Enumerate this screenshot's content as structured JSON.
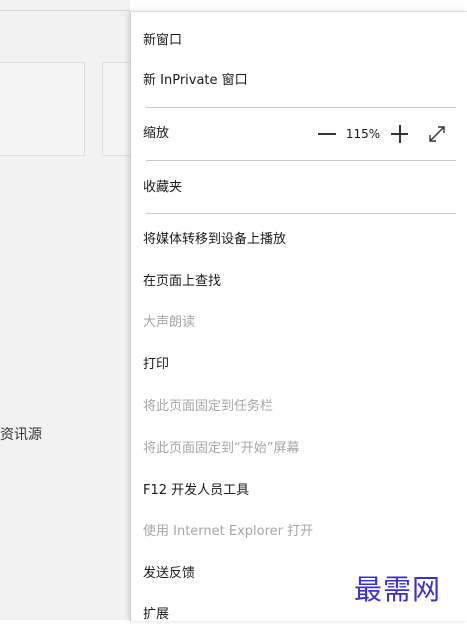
{
  "background": {
    "feed_label": "资讯源"
  },
  "menu": {
    "new_window": "新窗口",
    "new_inprivate": "新 InPrivate 窗口",
    "zoom": {
      "label": "缩放",
      "value": "115%"
    },
    "favorites": "收藏夹",
    "cast": "将媒体转移到设备上播放",
    "find": "在页面上查找",
    "read_aloud": "大声朗读",
    "print": "打印",
    "pin_taskbar": "将此页面固定到任务栏",
    "pin_start": "将此页面固定到“开始”屏幕",
    "dev_tools": "F12 开发人员工具",
    "open_ie": "使用 Internet Explorer 打开",
    "feedback": "发送反馈",
    "extensions": "扩展"
  },
  "watermark": "最需网",
  "colors": {
    "disabled_text": "#a6a6a6",
    "watermark": "#3a2fd0"
  }
}
